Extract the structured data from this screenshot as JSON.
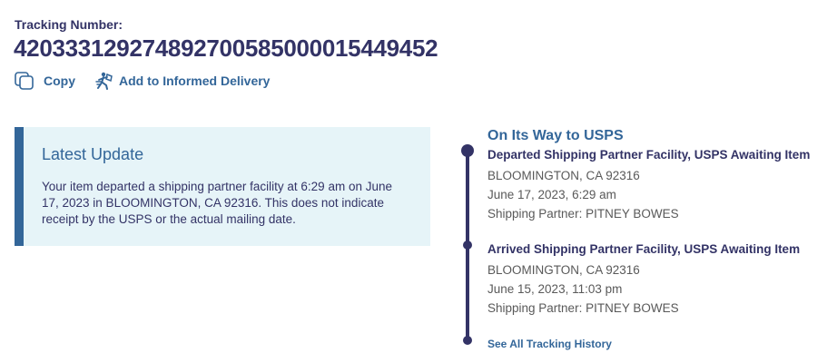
{
  "tracking": {
    "label": "Tracking Number:",
    "number": "420333129274892700585000015449452"
  },
  "actions": {
    "copy_label": "Copy",
    "informed_delivery_label": "Add to Informed Delivery"
  },
  "latest_update": {
    "heading": "Latest Update",
    "body": "Your item departed a shipping partner facility at 6:29 am on June 17, 2023 in BLOOMINGTON, CA 92316. This does not indicate receipt by the USPS or the actual mailing date."
  },
  "timeline": {
    "status_heading": "On Its Way to USPS",
    "events": [
      {
        "title": "Departed Shipping Partner Facility, USPS Awaiting Item",
        "location": "BLOOMINGTON, CA 92316",
        "datetime": "June 17, 2023, 6:29 am",
        "partner": "Shipping Partner: PITNEY BOWES"
      },
      {
        "title": "Arrived Shipping Partner Facility, USPS Awaiting Item",
        "location": "BLOOMINGTON, CA 92316",
        "datetime": "June 15, 2023, 11:03 pm",
        "partner": "Shipping Partner: PITNEY BOWES"
      }
    ],
    "history_link": "See All Tracking History"
  },
  "colors": {
    "navy": "#333366",
    "link_blue": "#336699",
    "panel_bg": "#e6f4f8",
    "gray_text": "#595959"
  }
}
